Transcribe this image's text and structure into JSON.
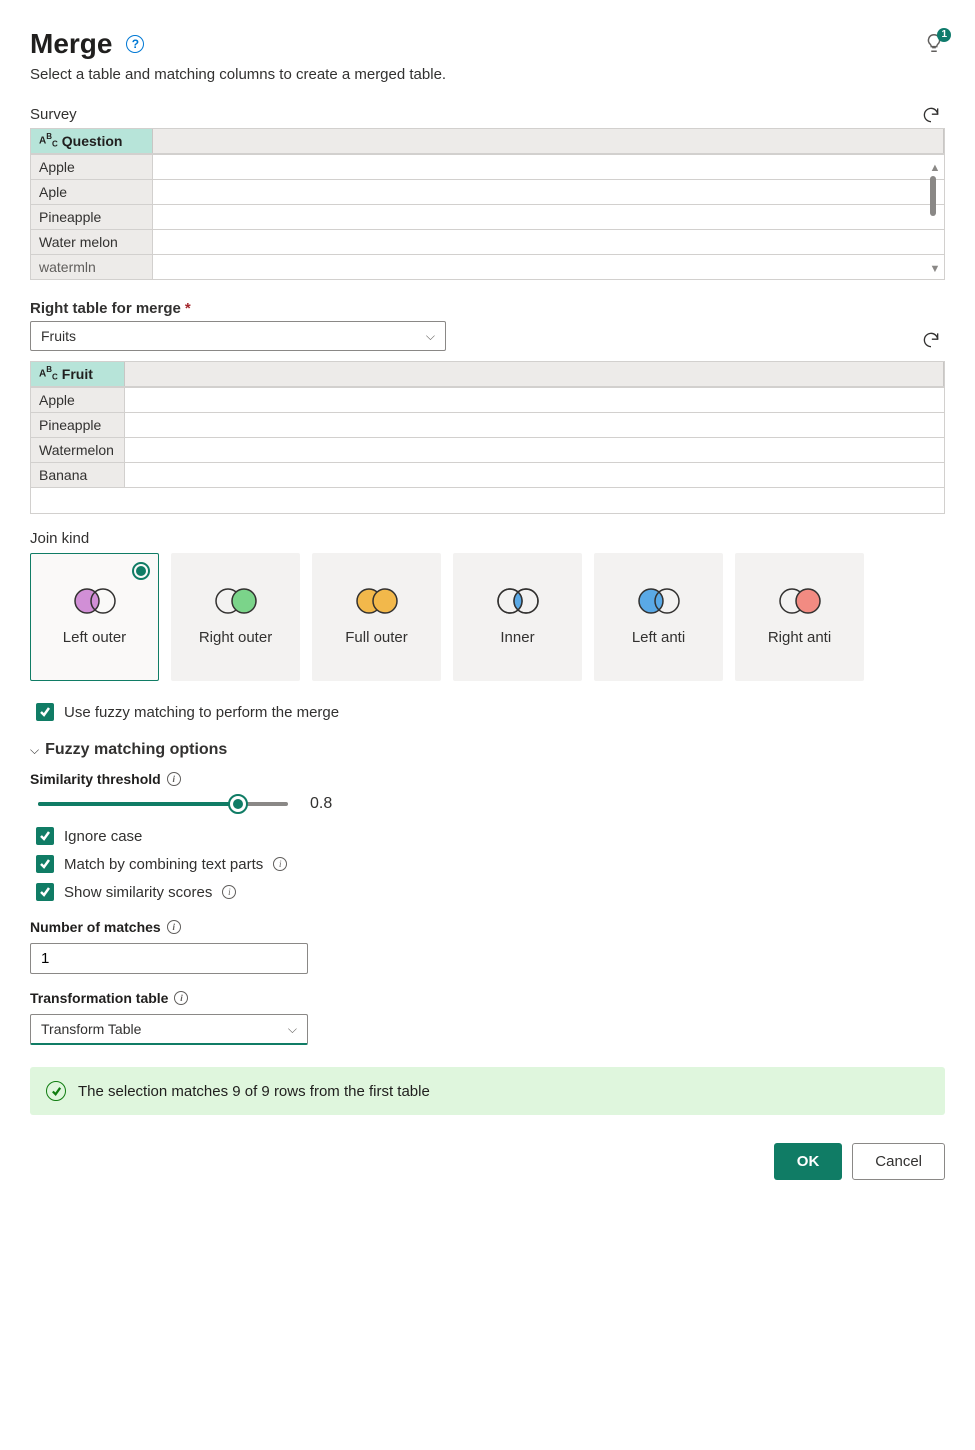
{
  "header": {
    "title": "Merge",
    "subtitle": "Select a table and matching columns to create a merged table.",
    "bulb_badge": "1"
  },
  "left_table": {
    "label": "Survey",
    "column": "Question",
    "rows": [
      "Apple",
      "Aple",
      "Pineapple",
      "Water melon",
      "watermln"
    ]
  },
  "right_table": {
    "section_label": "Right table for merge",
    "selected": "Fruits",
    "column": "Fruit",
    "rows": [
      "Apple",
      "Pineapple",
      "Watermelon",
      "Banana"
    ]
  },
  "join": {
    "label": "Join kind",
    "options": [
      {
        "label": "Left outer",
        "left_fill": "#d18fd6",
        "right_fill": "none",
        "selected": true
      },
      {
        "label": "Right outer",
        "left_fill": "none",
        "right_fill": "#7bd48a",
        "selected": false
      },
      {
        "label": "Full outer",
        "left_fill": "#f2b84b",
        "right_fill": "#f2b84b",
        "selected": false
      },
      {
        "label": "Inner",
        "left_fill": "none",
        "right_fill": "none",
        "center": "#5aa9e6",
        "selected": false
      },
      {
        "label": "Left anti",
        "left_fill": "#5aa9e6",
        "right_fill": "none",
        "selected": false
      },
      {
        "label": "Right anti",
        "left_fill": "none",
        "right_fill": "#f28b82",
        "selected": false
      }
    ]
  },
  "fuzzy": {
    "use_fuzzy_label": "Use fuzzy matching to perform the merge",
    "expander": "Fuzzy matching options",
    "threshold_label": "Similarity threshold",
    "threshold_value": "0.8",
    "threshold_pct": 80,
    "ignore_case": "Ignore case",
    "combine_parts": "Match by combining text parts",
    "show_scores": "Show similarity scores",
    "num_matches_label": "Number of matches",
    "num_matches_value": "1",
    "transform_label": "Transformation table",
    "transform_value": "Transform Table"
  },
  "status": "The selection matches 9 of 9 rows from the first table",
  "footer": {
    "ok": "OK",
    "cancel": "Cancel"
  }
}
